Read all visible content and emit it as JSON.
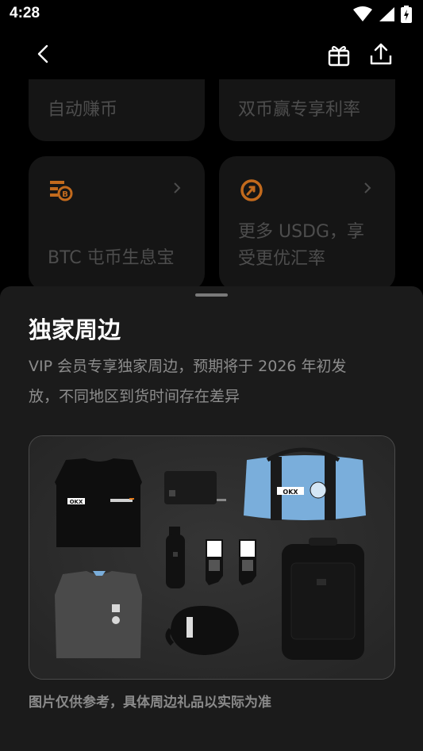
{
  "status_bar": {
    "time": "4:28",
    "icons": [
      "wifi-icon",
      "signal-icon",
      "battery-icon"
    ]
  },
  "nav": {
    "icons": [
      "back-icon",
      "gift-icon",
      "share-icon"
    ]
  },
  "cards": [
    {
      "label": "自动赚币"
    },
    {
      "label": "双币赢专享利率"
    },
    {
      "label": "BTC 屯币生息宝",
      "icon": "btc-savings-icon"
    },
    {
      "label": "更多 USDG，享受更优汇率",
      "label_line1": "更多 USDG，享",
      "label_line2": "受更优汇率",
      "icon": "usdg-rate-icon"
    }
  ],
  "sheet": {
    "title": "独家周边",
    "description": "VIP 会员专享独家周边，预期将于 2026 年初发放，不同地区到货时间存在差异",
    "description_line1": "VIP 会员专享独家周边，预期将于 2026 年初发",
    "description_line2": "放，不同地区到货时间存在差异",
    "note": "图片仅供参考，具体周边礼品以实际为准",
    "merch_brand": "OKX",
    "merch_items": [
      "black-tshirt",
      "card-wallet",
      "duffel-bag",
      "water-bottle",
      "socks",
      "backpack",
      "grey-sweatshirt",
      "cap"
    ]
  },
  "colors": {
    "background": "#000000",
    "card": "#151515",
    "sheet": "#1b1b1b",
    "muted_text": "#8c8c8c",
    "accent_orange": "#c26a1d",
    "bag_blue": "#7aaedb"
  }
}
